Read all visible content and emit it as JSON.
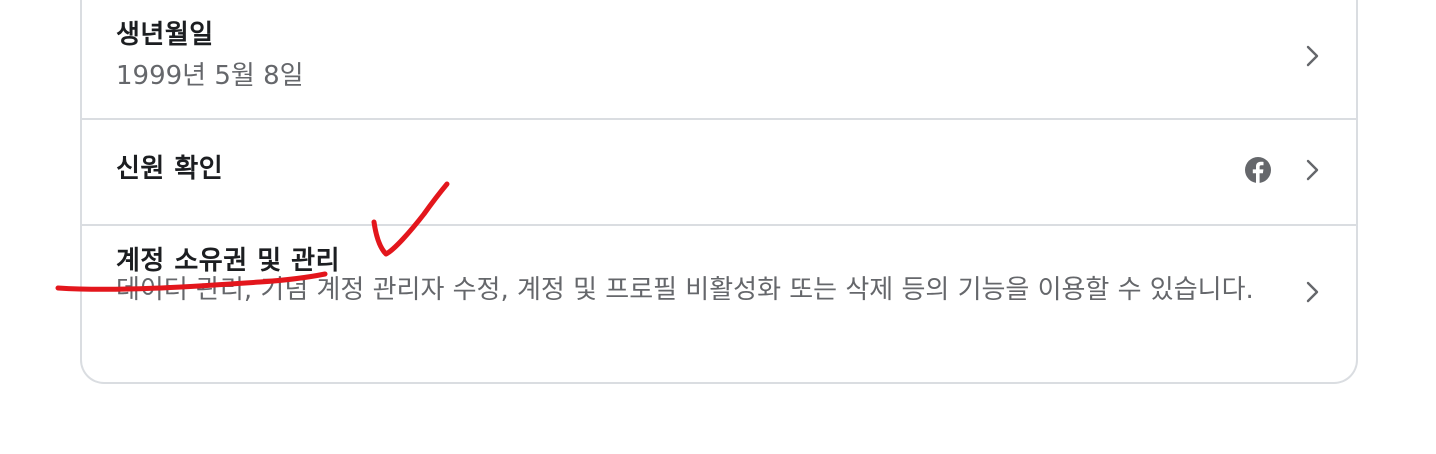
{
  "settings": {
    "birthday": {
      "title": "생년월일",
      "value": "1999년 5월 8일"
    },
    "identity": {
      "title": "신원 확인",
      "linked_icon": "facebook-icon"
    },
    "ownership": {
      "title": "계정 소유권 및 관리",
      "description": "데이터 관리, 기념 계정 관리자 수정, 계정 및 프로필 비활성화 또는 삭제 등의 기능을 이용할 수 있습니다."
    }
  },
  "annotation": {
    "color": "#e3161c",
    "marks": [
      "red-underline",
      "red-checkmark"
    ]
  },
  "colors": {
    "title": "#1c1e21",
    "subtitle": "#65676b",
    "border": "#dadde1",
    "icon": "#65676b"
  }
}
